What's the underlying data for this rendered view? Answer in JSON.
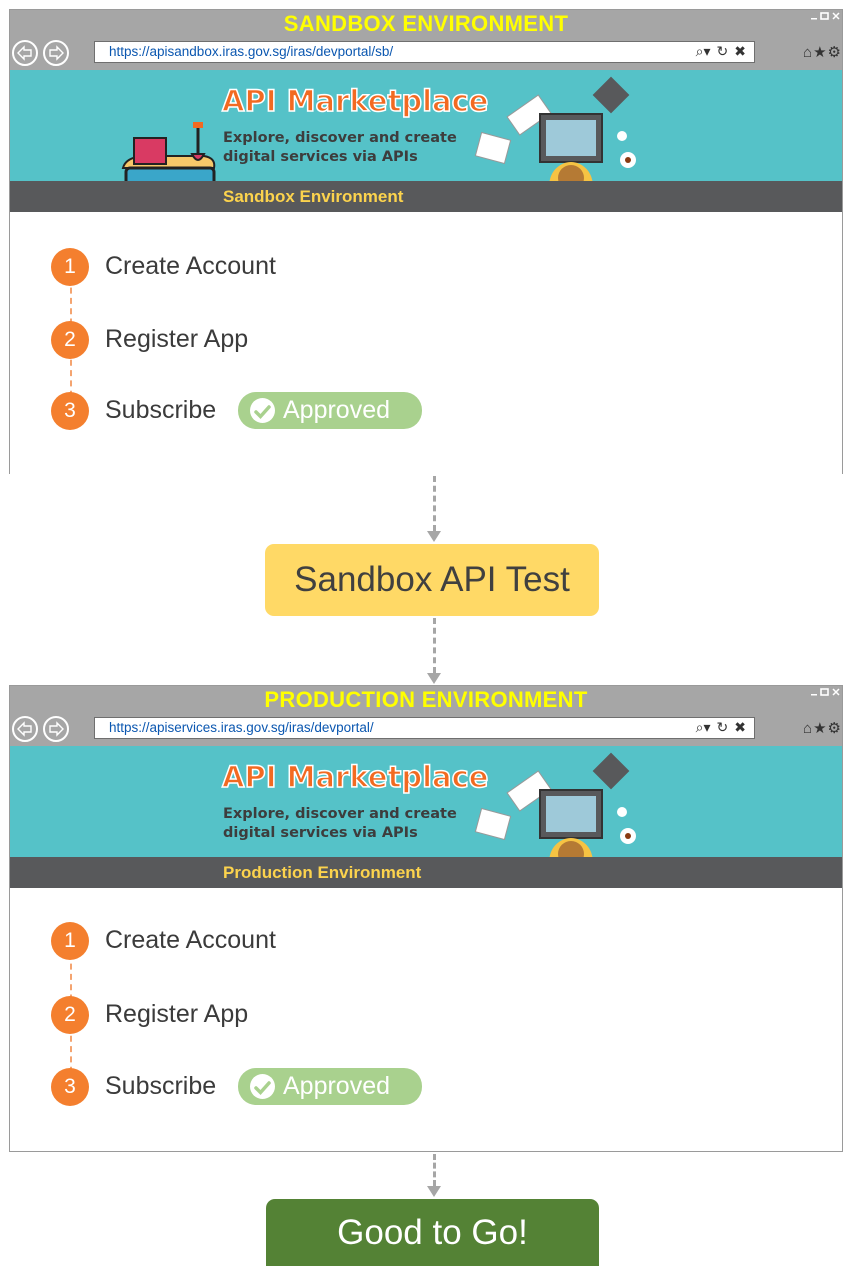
{
  "sandbox": {
    "title": "SANDBOX ENVIRONMENT",
    "url": "https://apisandbox.iras.gov.sg/iras/devportal/sb/",
    "banner_title": "API Marketplace",
    "banner_subtitle": "Explore, discover and create digital services via APIs",
    "environment_label": "Sandbox Environment",
    "steps": [
      {
        "number": "1",
        "label": "Create Account"
      },
      {
        "number": "2",
        "label": "Register App"
      },
      {
        "number": "3",
        "label": "Subscribe"
      }
    ],
    "approved_label": "Approved"
  },
  "middle_box": "Sandbox API Test",
  "production": {
    "title": "PRODUCTION ENVIRONMENT",
    "url": "https://apiservices.iras.gov.sg/iras/devportal/",
    "banner_title": "API Marketplace",
    "banner_subtitle": "Explore, discover and create digital services via APIs",
    "environment_label": "Production Environment",
    "steps": [
      {
        "number": "1",
        "label": "Create Account"
      },
      {
        "number": "2",
        "label": "Register App"
      },
      {
        "number": "3",
        "label": "Subscribe"
      }
    ],
    "approved_label": "Approved"
  },
  "final_box": "Good to Go!",
  "icons": [
    "back-arrow-icon",
    "forward-arrow-icon",
    "search-icon",
    "refresh-icon",
    "stop-icon",
    "home-icon",
    "favorites-star-icon",
    "settings-gear-icon",
    "checkmark-icon",
    "sand-bucket-illustration",
    "laptop-user-illustration"
  ],
  "colors": {
    "title_yellow": "#ffff00",
    "banner_teal": "#55c2c8",
    "step_orange": "#f47f2e",
    "approved_green": "#a9d18e",
    "test_box_yellow": "#ffd966",
    "go_box_green": "#548235"
  }
}
